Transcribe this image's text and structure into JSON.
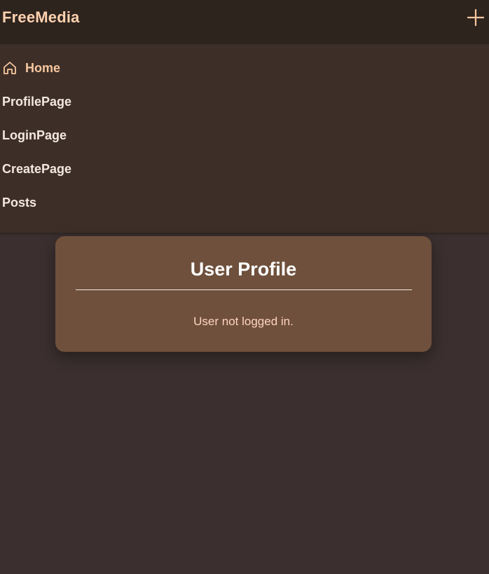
{
  "app": {
    "brand": "FreeMedia"
  },
  "nav": {
    "items": [
      {
        "label": "Home",
        "icon": "home-icon",
        "active": true
      },
      {
        "label": "ProfilePage"
      },
      {
        "label": "LoginPage"
      },
      {
        "label": "CreatePage"
      },
      {
        "label": "Posts"
      }
    ]
  },
  "profile_card": {
    "title": "User Profile",
    "message": "User not logged in."
  },
  "colors": {
    "accent": "#f7c7a0",
    "topbar": "#2e241e",
    "nav_panel": "#3d2f27",
    "card": "#6e503c",
    "background": "#3b2f2f"
  }
}
